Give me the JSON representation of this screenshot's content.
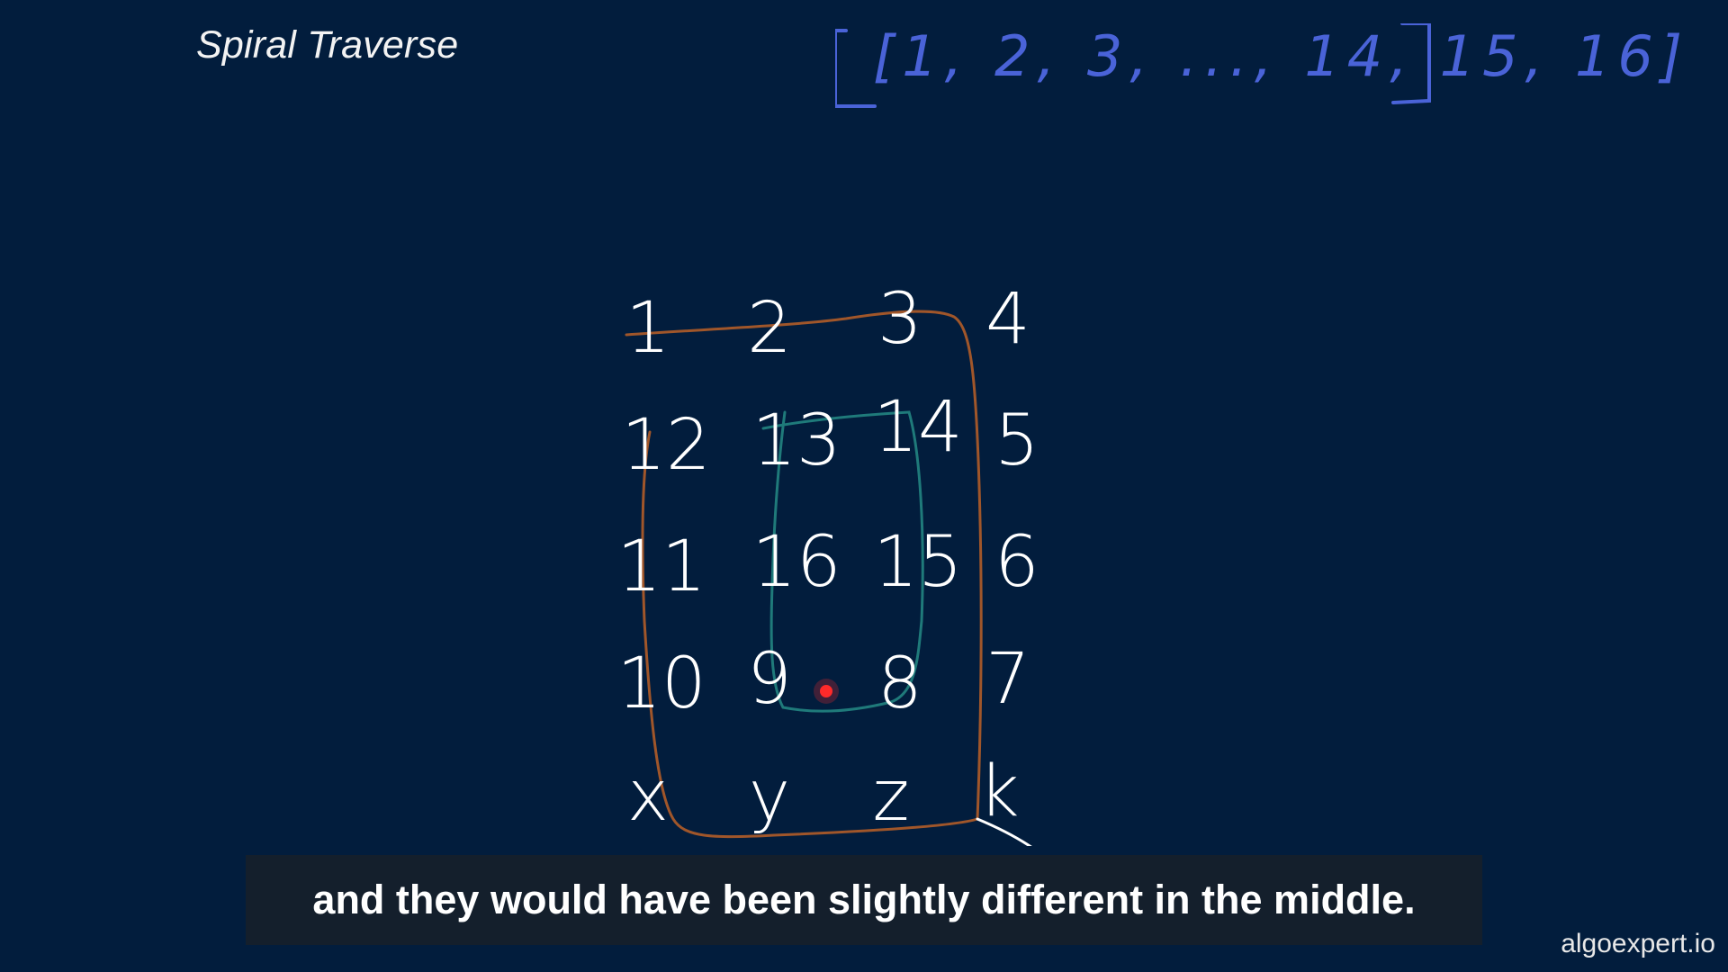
{
  "slide": {
    "title": "Spiral Traverse",
    "output_array": "[1, 2, 3, ..., 14, 15, 16]"
  },
  "matrix": {
    "rows": [
      [
        "1",
        "2",
        "3",
        "4"
      ],
      [
        "12",
        "13",
        "14",
        "5"
      ],
      [
        "11",
        "16",
        "15",
        "6"
      ],
      [
        "10",
        "9",
        "8",
        "7"
      ],
      [
        "x",
        "y",
        "z",
        "k"
      ]
    ],
    "outer_path_color": "#a0562a",
    "inner_path_color": "#1f7a7a",
    "pointer_color": "#ff2a2a"
  },
  "caption": {
    "text": "and they would have been slightly different in the middle."
  },
  "watermark": {
    "text": "algoexpert.io"
  }
}
